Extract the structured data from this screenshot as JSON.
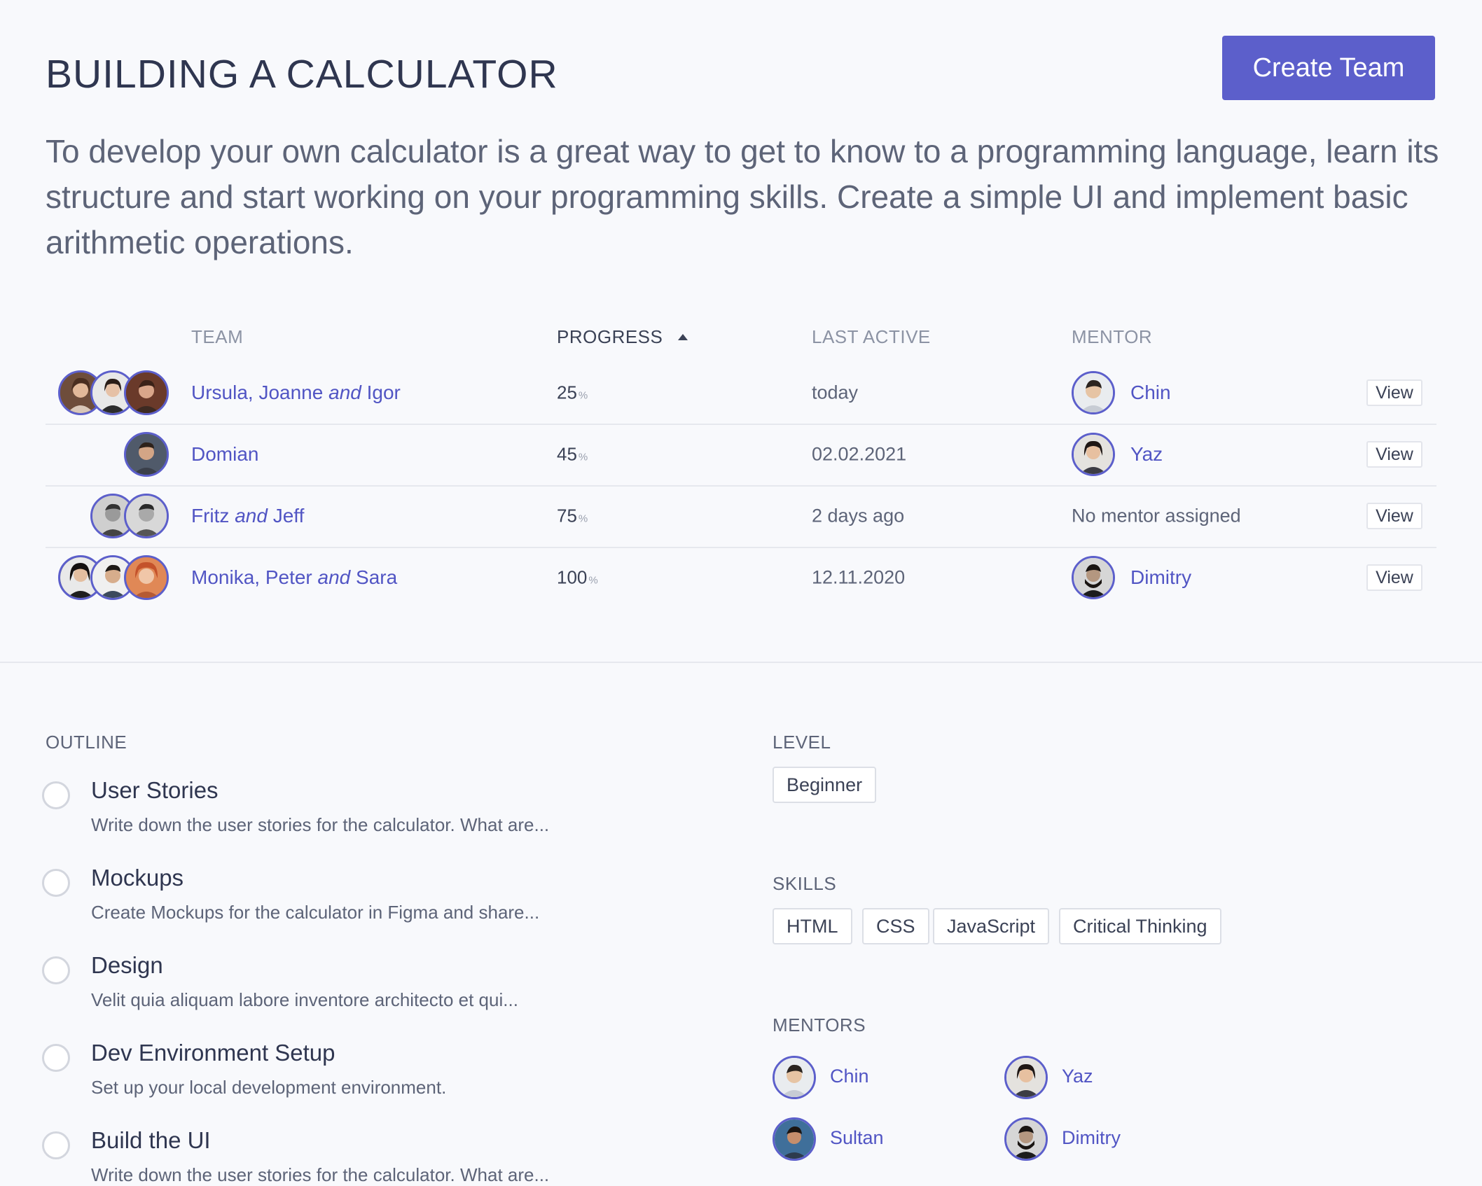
{
  "header": {
    "title": "BUILDING A CALCULATOR",
    "create_team_label": "Create Team",
    "description": "To develop your own calculator is a great way to get to know to a programming language, learn its structure and start working on your programming skills. Create a simple UI and implement basic arithmetic operations."
  },
  "table": {
    "columns": {
      "team": "TEAM",
      "progress": "PROGRESS",
      "last_active": "LAST ACTIVE",
      "mentor": "MENTOR"
    },
    "percent_sign": "%",
    "view_label": "View",
    "rows": [
      {
        "members": [
          "Ursula",
          "Joanne",
          "Igor"
        ],
        "name_first": "Ursula, Joanne",
        "name_and": "and",
        "name_last": "Igor",
        "progress": "25",
        "last_active": "today",
        "mentor": "Chin"
      },
      {
        "members": [
          "Domian"
        ],
        "name_first": "Domian",
        "name_and": "",
        "name_last": "",
        "progress": "45",
        "last_active": "02.02.2021",
        "mentor": "Yaz"
      },
      {
        "members": [
          "Fritz",
          "Jeff"
        ],
        "name_first": "Fritz",
        "name_and": "and",
        "name_last": "Jeff",
        "progress": "75",
        "last_active": "2 days ago",
        "mentor": "No mentor assigned"
      },
      {
        "members": [
          "Monika",
          "Peter",
          "Sara"
        ],
        "name_first": "Monika, Peter",
        "name_and": "and",
        "name_last": "Sara",
        "progress": "100",
        "last_active": "12.11.2020",
        "mentor": "Dimitry"
      }
    ]
  },
  "outline": {
    "label": "OUTLINE",
    "items": [
      {
        "title": "User Stories",
        "desc": "Write down the user stories for the calculator. What are..."
      },
      {
        "title": "Mockups",
        "desc": "Create Mockups for the calculator in Figma and share..."
      },
      {
        "title": "Design",
        "desc": "Velit quia aliquam labore inventore architecto et qui..."
      },
      {
        "title": "Dev Environment Setup",
        "desc": "Set up your local development environment."
      },
      {
        "title": "Build the UI",
        "desc": "Write down the user stories for the calculator. What are..."
      }
    ]
  },
  "level": {
    "label": "LEVEL",
    "value": "Beginner"
  },
  "skills": {
    "label": "SKILLS",
    "items": [
      "HTML",
      "CSS",
      "JavaScript",
      "Critical Thinking"
    ]
  },
  "mentors": {
    "label": "MENTORS",
    "items": [
      "Chin",
      "Yaz",
      "Sultan",
      "Dimitry"
    ]
  },
  "colors": {
    "accent": "#5c5fcb",
    "link": "#5155c4",
    "background": "#f8f9fc"
  },
  "icons": {
    "sort": "sort-ascending-caret-icon",
    "outline_status": "empty-circle-checkbox-icon"
  }
}
